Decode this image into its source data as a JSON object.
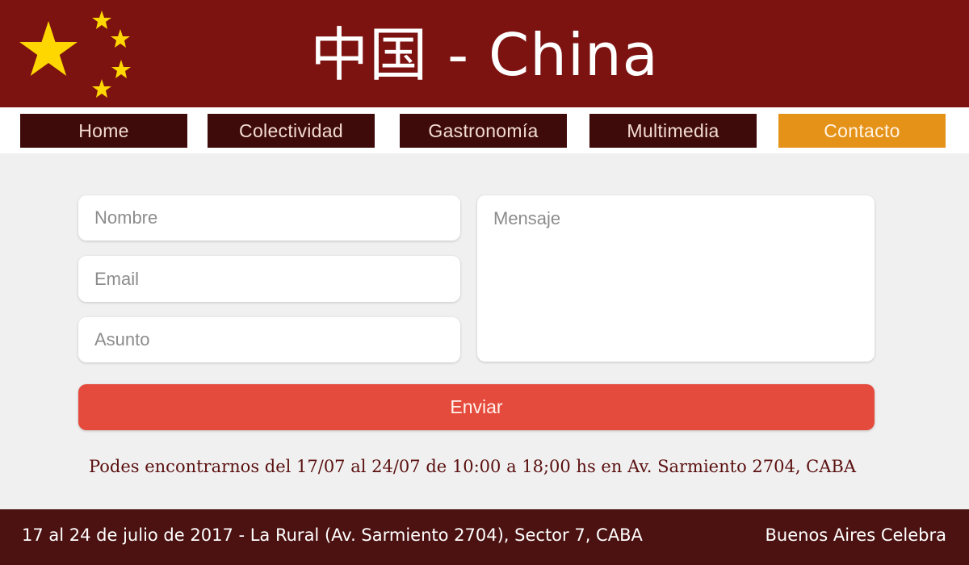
{
  "header": {
    "title": "中国 - China",
    "flag_colors": {
      "background": "#7d1311",
      "star": "#ffd700"
    }
  },
  "nav": {
    "items": [
      {
        "label": "Home"
      },
      {
        "label": "Colectividad"
      },
      {
        "label": "Gastronomía"
      },
      {
        "label": "Multimedia"
      },
      {
        "label": "Contacto",
        "active": true
      }
    ],
    "colors": {
      "default": "#3e0a0a",
      "active": "#e59219"
    }
  },
  "form": {
    "name_placeholder": "Nombre",
    "email_placeholder": "Email",
    "subject_placeholder": "Asunto",
    "message_placeholder": "Mensaje",
    "submit_label": "Enviar",
    "submit_color": "#e54b3c"
  },
  "info": {
    "text": "Podes encontrarnos del 17/07 al 24/07 de 10:00 a 18;00 hs en Av. Sarmiento 2704, CABA"
  },
  "footer": {
    "left_text": "17 al 24 de julio de 2017 - La Rural (Av. Sarmiento 2704), Sector 7, CABA",
    "right_text": "Buenos Aires Celebra"
  }
}
